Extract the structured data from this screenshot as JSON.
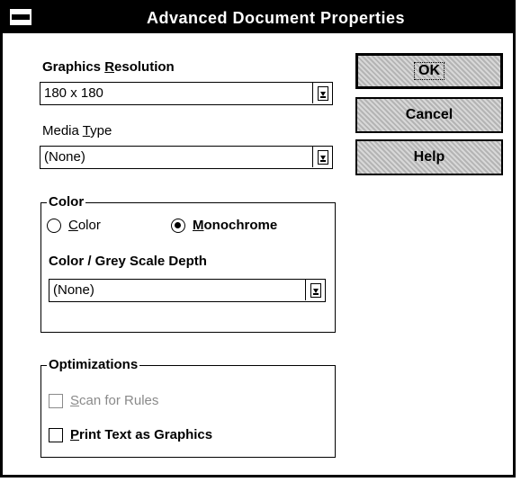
{
  "window": {
    "title": "Advanced Document Properties"
  },
  "graphics_resolution": {
    "label_pre": "Graphics ",
    "label_accel": "R",
    "label_post": "esolution",
    "value": "180 x 180"
  },
  "media_type": {
    "label_pre": "Media ",
    "label_accel": "T",
    "label_post": "ype",
    "value": "(None)"
  },
  "buttons": {
    "ok": "OK",
    "cancel": "Cancel",
    "help": "Help"
  },
  "color_group": {
    "title": "Color",
    "option_color": {
      "accel": "C",
      "rest": "olor",
      "selected": false
    },
    "option_mono": {
      "accel": "M",
      "rest": "onochrome",
      "selected": true
    },
    "depth_label": "Color / Grey Scale Depth",
    "depth_value": "(None)"
  },
  "optimizations": {
    "title": "Optimizations",
    "scan_rules": {
      "accel": "S",
      "rest": "can for Rules",
      "checked": false,
      "enabled": false
    },
    "print_text": {
      "accel": "P",
      "rest": "rint Text as Graphics",
      "checked": false,
      "enabled": true
    }
  }
}
